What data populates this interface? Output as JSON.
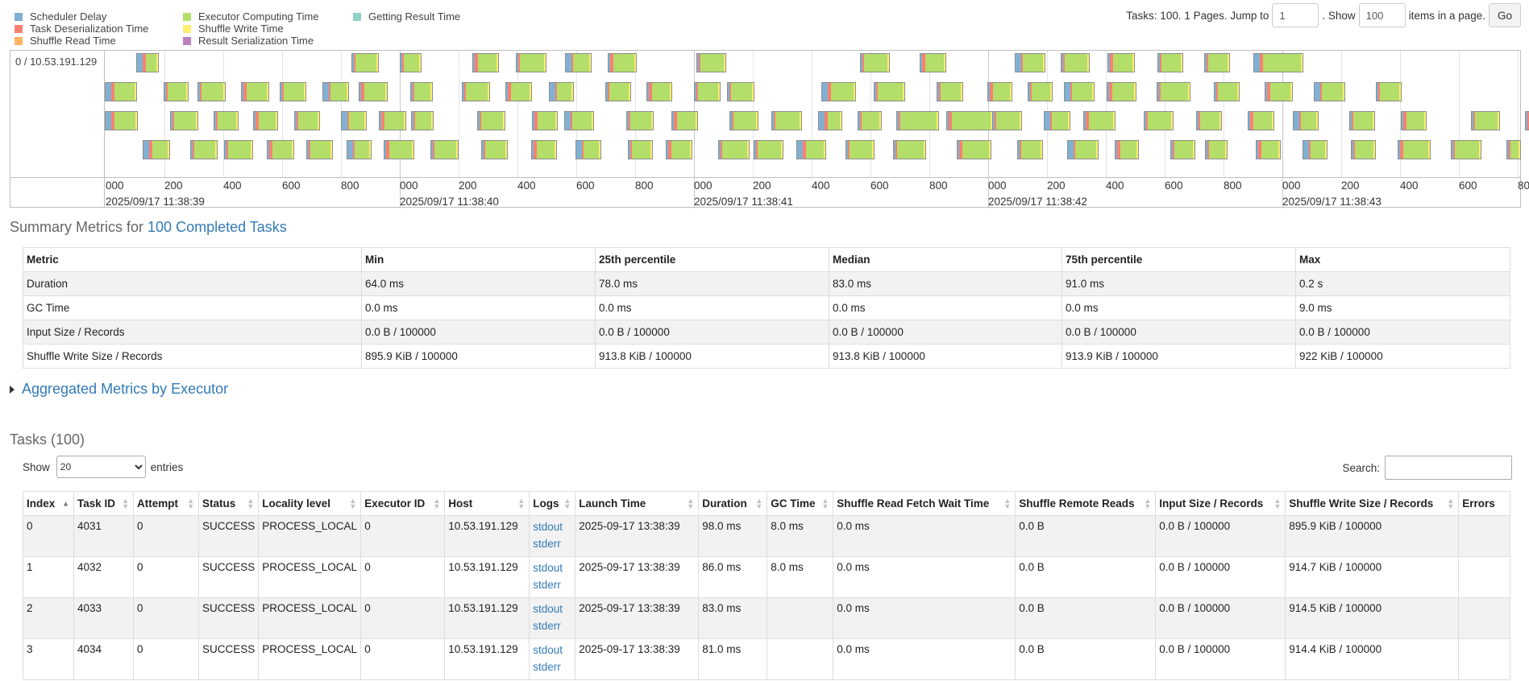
{
  "legend": {
    "items": [
      {
        "label": "Scheduler Delay",
        "color": "#80B1D3"
      },
      {
        "label": "Task Deserialization Time",
        "color": "#FB8072"
      },
      {
        "label": "Shuffle Read Time",
        "color": "#FDB462"
      },
      {
        "label": "Executor Computing Time",
        "color": "#B3DE69"
      },
      {
        "label": "Shuffle Write Time",
        "color": "#FFED6F"
      },
      {
        "label": "Result Serialization Time",
        "color": "#BC80BD"
      },
      {
        "label": "Getting Result Time",
        "color": "#8DD3C7"
      }
    ]
  },
  "paging": {
    "prefix": "Tasks: 100. 1 Pages. Jump to",
    "page_value": "1",
    "show_label": ". Show",
    "show_value": "100",
    "suffix": "items in a page.",
    "go_label": "Go"
  },
  "timeline": {
    "executor_label": "0 / 10.53.191.129",
    "tick_labels": [
      "000",
      "200",
      "400",
      "600",
      "800"
    ],
    "last_tick_label": "8",
    "dates": [
      "2025/09/17 11:38:39",
      "2025/09/17 11:38:40",
      "2025/09/17 11:38:41",
      "2025/09/17 11:38:42",
      "2025/09/17 11:38:43"
    ]
  },
  "summary": {
    "title_prefix": "Summary Metrics for ",
    "title_link": "100 Completed Tasks",
    "headers": [
      "Metric",
      "Min",
      "25th percentile",
      "Median",
      "75th percentile",
      "Max"
    ],
    "rows": [
      [
        "Duration",
        "64.0 ms",
        "78.0 ms",
        "83.0 ms",
        "91.0 ms",
        "0.2 s"
      ],
      [
        "GC Time",
        "0.0 ms",
        "0.0 ms",
        "0.0 ms",
        "0.0 ms",
        "9.0 ms"
      ],
      [
        "Input Size / Records",
        "0.0 B / 100000",
        "0.0 B / 100000",
        "0.0 B / 100000",
        "0.0 B / 100000",
        "0.0 B / 100000"
      ],
      [
        "Shuffle Write Size / Records",
        "895.9 KiB / 100000",
        "913.8 KiB / 100000",
        "913.8 KiB / 100000",
        "913.9 KiB / 100000",
        "922 KiB / 100000"
      ]
    ]
  },
  "aggregated": {
    "label": "Aggregated Metrics by Executor"
  },
  "tasks_section": {
    "title": "Tasks (100)",
    "show_label": "Show",
    "show_value": "20",
    "entries_label": "entries",
    "search_label": "Search:"
  },
  "tasks": {
    "headers": [
      "Index",
      "Task ID",
      "Attempt",
      "Status",
      "Locality level",
      "Executor ID",
      "Host",
      "Logs",
      "Launch Time",
      "Duration",
      "GC Time",
      "Shuffle Read Fetch Wait Time",
      "Shuffle Remote Reads",
      "Input Size / Records",
      "Shuffle Write Size / Records",
      "Errors"
    ],
    "rows": [
      {
        "index": "0",
        "task_id": "4031",
        "attempt": "0",
        "status": "SUCCESS",
        "locality": "PROCESS_LOCAL",
        "executor": "0",
        "host": "10.53.191.129",
        "stdout": "stdout",
        "stderr": "stderr",
        "launch": "2025-09-17 13:38:39",
        "duration": "98.0 ms",
        "gc": "8.0 ms",
        "fetch_wait": "0.0 ms",
        "remote_reads": "0.0 B",
        "input": "0.0 B / 100000",
        "shuffle_write": "895.9 KiB / 100000",
        "errors": ""
      },
      {
        "index": "1",
        "task_id": "4032",
        "attempt": "0",
        "status": "SUCCESS",
        "locality": "PROCESS_LOCAL",
        "executor": "0",
        "host": "10.53.191.129",
        "stdout": "stdout",
        "stderr": "stderr",
        "launch": "2025-09-17 13:38:39",
        "duration": "86.0 ms",
        "gc": "8.0 ms",
        "fetch_wait": "0.0 ms",
        "remote_reads": "0.0 B",
        "input": "0.0 B / 100000",
        "shuffle_write": "914.7 KiB / 100000",
        "errors": ""
      },
      {
        "index": "2",
        "task_id": "4033",
        "attempt": "0",
        "status": "SUCCESS",
        "locality": "PROCESS_LOCAL",
        "executor": "0",
        "host": "10.53.191.129",
        "stdout": "stdout",
        "stderr": "stderr",
        "launch": "2025-09-17 13:38:39",
        "duration": "83.0 ms",
        "gc": "",
        "fetch_wait": "0.0 ms",
        "remote_reads": "0.0 B",
        "input": "0.0 B / 100000",
        "shuffle_write": "914.5 KiB / 100000",
        "errors": ""
      },
      {
        "index": "3",
        "task_id": "4034",
        "attempt": "0",
        "status": "SUCCESS",
        "locality": "PROCESS_LOCAL",
        "executor": "0",
        "host": "10.53.191.129",
        "stdout": "stdout",
        "stderr": "stderr",
        "launch": "2025-09-17 13:38:39",
        "duration": "81.0 ms",
        "gc": "",
        "fetch_wait": "0.0 ms",
        "remote_reads": "0.0 B",
        "input": "0.0 B / 100000",
        "shuffle_write": "914.4 KiB / 100000",
        "errors": ""
      }
    ]
  }
}
